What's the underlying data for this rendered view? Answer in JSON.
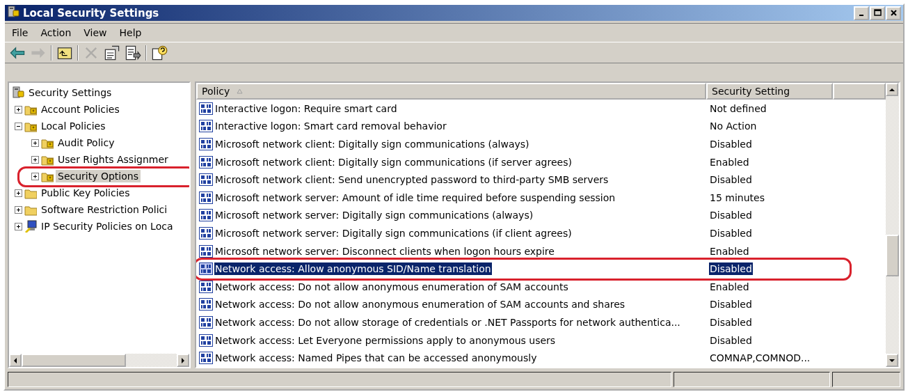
{
  "window": {
    "title": "Local Security Settings"
  },
  "menu": [
    "File",
    "Action",
    "View",
    "Help"
  ],
  "toolbar": [
    {
      "kind": "back",
      "disabled": false
    },
    {
      "kind": "forward",
      "disabled": true
    },
    {
      "kind": "separator"
    },
    {
      "kind": "up",
      "disabled": false
    },
    {
      "kind": "separator"
    },
    {
      "kind": "delete",
      "disabled": true
    },
    {
      "kind": "properties",
      "disabled": false
    },
    {
      "kind": "export",
      "disabled": false
    },
    {
      "kind": "separator"
    },
    {
      "kind": "help",
      "disabled": false
    }
  ],
  "tree": [
    {
      "label": "Security Settings",
      "kind": "server",
      "selected": false,
      "circled": false,
      "children": [
        {
          "label": "Account Policies",
          "kind": "locked-folder",
          "expanded": false,
          "selected": false,
          "circled": false
        },
        {
          "label": "Local Policies",
          "kind": "locked-folder",
          "expanded": true,
          "selected": false,
          "circled": false,
          "children": [
            {
              "label": "Audit Policy",
              "kind": "locked-folder",
              "expanded": false,
              "selected": false,
              "circled": false
            },
            {
              "label": "User Rights Assignmer",
              "kind": "locked-folder",
              "expanded": false,
              "selected": false,
              "circled": false
            },
            {
              "label": "Security Options",
              "kind": "locked-folder",
              "expanded": false,
              "selected": true,
              "circled": true
            }
          ]
        },
        {
          "label": "Public Key Policies",
          "kind": "folder",
          "expanded": false,
          "selected": false,
          "circled": false
        },
        {
          "label": "Software Restriction Polici",
          "kind": "folder",
          "expanded": false,
          "selected": false,
          "circled": false
        },
        {
          "label": "IP Security Policies on Loca",
          "kind": "computer",
          "expanded": false,
          "selected": false,
          "circled": false
        }
      ]
    }
  ],
  "table": {
    "columns": [
      {
        "kind": "label",
        "label": "Policy",
        "sorted": true
      },
      {
        "kind": "label",
        "label": "Security Setting",
        "sorted": false
      },
      {
        "kind": "filler"
      }
    ],
    "rows": [
      {
        "policy": "Interactive logon: Require smart card",
        "setting": "Not defined",
        "selected": false,
        "circled": false
      },
      {
        "policy": "Interactive logon: Smart card removal behavior",
        "setting": "No Action",
        "selected": false,
        "circled": false
      },
      {
        "policy": "Microsoft network client: Digitally sign communications (always)",
        "setting": "Disabled",
        "selected": false,
        "circled": false
      },
      {
        "policy": "Microsoft network client: Digitally sign communications (if server agrees)",
        "setting": "Enabled",
        "selected": false,
        "circled": false
      },
      {
        "policy": "Microsoft network client: Send unencrypted password to third-party SMB servers",
        "setting": "Disabled",
        "selected": false,
        "circled": false
      },
      {
        "policy": "Microsoft network server: Amount of idle time required before suspending session",
        "setting": "15 minutes",
        "selected": false,
        "circled": false
      },
      {
        "policy": "Microsoft network server: Digitally sign communications (always)",
        "setting": "Disabled",
        "selected": false,
        "circled": false
      },
      {
        "policy": "Microsoft network server: Digitally sign communications (if client agrees)",
        "setting": "Disabled",
        "selected": false,
        "circled": false
      },
      {
        "policy": "Microsoft network server: Disconnect clients when logon hours expire",
        "setting": "Enabled",
        "selected": false,
        "circled": false
      },
      {
        "policy": "Network access: Allow anonymous SID/Name translation",
        "setting": "Disabled",
        "selected": true,
        "circled": true
      },
      {
        "policy": "Network access: Do not allow anonymous enumeration of SAM accounts",
        "setting": "Enabled",
        "selected": false,
        "circled": false
      },
      {
        "policy": "Network access: Do not allow anonymous enumeration of SAM accounts and shares",
        "setting": "Disabled",
        "selected": false,
        "circled": false
      },
      {
        "policy": "Network access: Do not allow storage of credentials or .NET Passports for network authentica...",
        "setting": "Disabled",
        "selected": false,
        "circled": false
      },
      {
        "policy": "Network access: Let Everyone permissions apply to anonymous users",
        "setting": "Disabled",
        "selected": false,
        "circled": false
      },
      {
        "policy": "Network access: Named Pipes that can be accessed anonymously",
        "setting": "COMNAP,COMNOD...",
        "selected": false,
        "circled": false
      }
    ]
  }
}
